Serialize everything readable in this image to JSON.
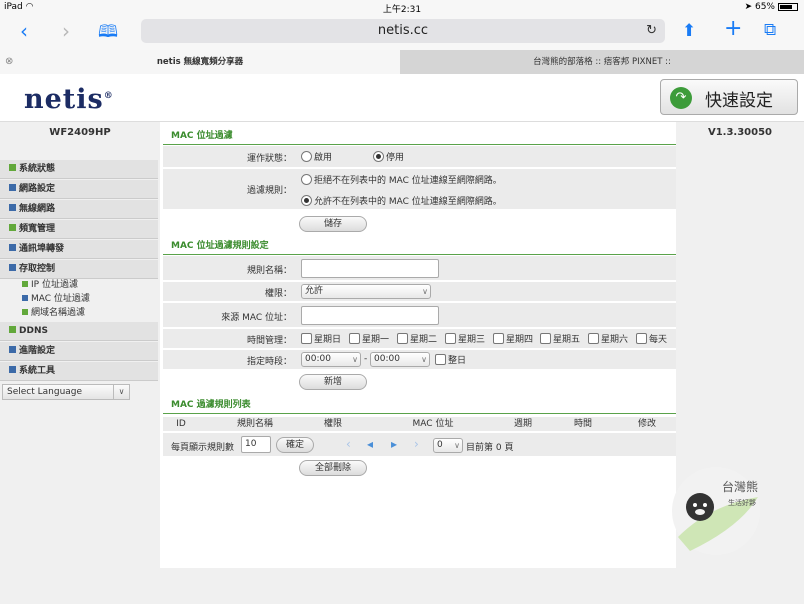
{
  "status": {
    "device": "iPad",
    "time": "上午2:31",
    "battery": "65%"
  },
  "browser": {
    "url": "netis.cc",
    "tabs": [
      {
        "label": "netis 無線寬頻分享器"
      },
      {
        "label": "台灣熊的部落格 :: 痞客邦 PIXNET ::"
      }
    ],
    "tab_close": "⊗"
  },
  "header": {
    "logo": "netis",
    "quick_setup": "快速設定"
  },
  "model": "WF2409HP",
  "version": "V1.3.30050",
  "sidebar": {
    "items": [
      {
        "label": "系統狀態"
      },
      {
        "label": "網路設定"
      },
      {
        "label": "無線網路"
      },
      {
        "label": "頻寬管理"
      },
      {
        "label": "通訊埠轉發"
      },
      {
        "label": "存取控制"
      },
      {
        "label": "DDNS"
      },
      {
        "label": "進階設定"
      },
      {
        "label": "系統工具"
      }
    ],
    "subitems": [
      {
        "label": "IP 位址過濾"
      },
      {
        "label": "MAC 位址過濾"
      },
      {
        "label": "網域名稱過濾"
      }
    ],
    "language": "Select Language"
  },
  "mac_filter": {
    "title": "MAC 位址過濾",
    "status_label": "運作狀態：",
    "status_options": [
      "啟用",
      "停用"
    ],
    "status_selected": "停用",
    "rule_label": "過濾規則：",
    "rule_options": [
      "拒絕不在列表中的 MAC 位址連線至網際網路。",
      "允許不在列表中的 MAC 位址連線至網際網路。"
    ],
    "rule_selected": 1,
    "save": "儲存"
  },
  "rule_settings": {
    "title": "MAC 位址過濾規則設定",
    "name_label": "規則名稱：",
    "name_value": "",
    "permission_label": "權限：",
    "permission_value": "允許",
    "source_mac_label": "來源 MAC 位址：",
    "source_mac_value": "",
    "schedule_label": "時間管理：",
    "days": [
      "星期日",
      "星期一",
      "星期二",
      "星期三",
      "星期四",
      "星期五",
      "星期六",
      "每天"
    ],
    "period_label": "指定時段：",
    "start_time": "00:00",
    "separator": "-",
    "end_time": "00:00",
    "all_day": "整日",
    "add": "新增"
  },
  "rule_list": {
    "title": "MAC 過濾規則列表",
    "columns": [
      "ID",
      "規則名稱",
      "權限",
      "MAC 位址",
      "週期",
      "時間",
      "修改"
    ],
    "per_page_label": "每頁顯示規則數",
    "per_page_value": "10",
    "confirm": "確定",
    "page_select": "0",
    "current_page": "目前第 0 頁",
    "delete_all": "全部刪除"
  },
  "colors": {
    "accent_green": "#3b8c2e",
    "ios_blue": "#1a7cf5",
    "nav_square_green": "#62a83b",
    "nav_square_blue": "#3c6aa8"
  }
}
